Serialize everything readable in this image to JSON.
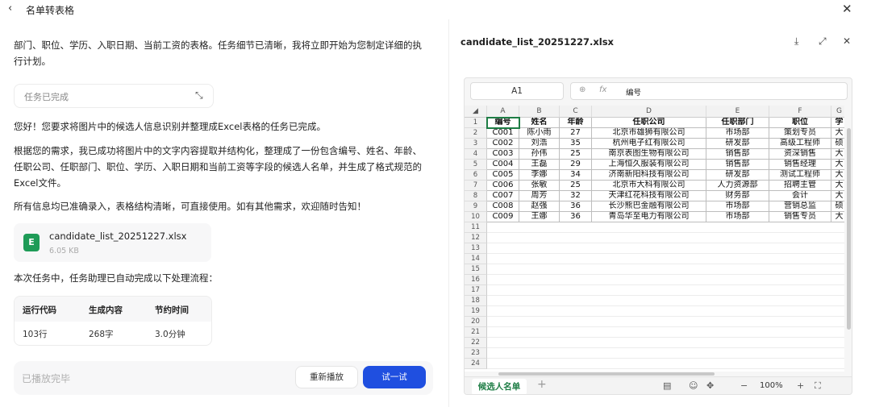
{
  "header": {
    "title": "名单转表格",
    "back": "‹",
    "close": "✕"
  },
  "chat": {
    "line1": "部门、职位、学历、入职日期、当前工资的表格。任务细节已清晰，我将立即开始为您制定详细的执",
    "line2": "行计划。",
    "status_label": "任务已完成",
    "msg1": "您好！您要求将图片中的候选人信息识别并整理成Excel表格的任务已完成。",
    "msg2a": "根据您的需求，我已成功将图片中的文字内容提取并结构化，整理成了一份包含编号、姓名、年龄、",
    "msg2b": "任职公司、任职部门、职位、学历、入职日期和当前工资等字段的候选人名单，并生成了格式规范的",
    "msg2c": "Excel文件。",
    "msg3": "所有信息均已准确录入，表格结构清晰，可直接使用。如有其他需求，欢迎随时告知！",
    "file": {
      "name": "candidate_list_20251227.xlsx",
      "size": "6.05 KB",
      "icon": "E"
    },
    "process_intro": "本次任务中，任务助理已自动完成以下处理流程：",
    "stats": {
      "headers": [
        "运行代码",
        "生成内容",
        "节约时间"
      ],
      "values": [
        "103行",
        "268字",
        "3.0分钟"
      ]
    },
    "composer": {
      "placeholder": "已播放完毕",
      "replay": "重新播放",
      "try": "试一试"
    }
  },
  "viewer": {
    "title": "candidate_list_20251227.xlsx",
    "icons": [
      "download-icon",
      "expand-icon",
      "close-icon"
    ],
    "namebox": "A1",
    "formula_value": "编号",
    "columns": [
      "A",
      "B",
      "C",
      "D",
      "E",
      "F",
      "G"
    ],
    "rows": [
      [
        "编号",
        "姓名",
        "年龄",
        "任职公司",
        "任职部门",
        "职位",
        "学"
      ],
      [
        "C001",
        "陈小雨",
        "27",
        "北京市雄狮有限公司",
        "市场部",
        "策划专员",
        "大"
      ],
      [
        "C002",
        "刘浩",
        "35",
        "杭州电子红有限公司",
        "研发部",
        "高级工程师",
        "硕"
      ],
      [
        "C003",
        "孙伟",
        "25",
        "南京表图生物有限公司",
        "销售部",
        "资深销售",
        "大"
      ],
      [
        "C004",
        "王磊",
        "29",
        "上海恒久服装有限公司",
        "销售部",
        "销售经理",
        "大"
      ],
      [
        "C005",
        "李娜",
        "34",
        "济南新阳科技有限公司",
        "研发部",
        "测试工程师",
        "大"
      ],
      [
        "C006",
        "张敏",
        "25",
        "北京市大科有限公司",
        "人力资源部",
        "招聘主管",
        "大"
      ],
      [
        "C007",
        "周芳",
        "32",
        "天津红花科技有限公司",
        "财务部",
        "会计",
        "大"
      ],
      [
        "C008",
        "赵强",
        "36",
        "长沙熊巴金融有限公司",
        "市场部",
        "营销总监",
        "硕"
      ],
      [
        "C009",
        "王娜",
        "36",
        "青岛华至电力有限公司",
        "市场部",
        "销售专员",
        "大"
      ]
    ],
    "row_numbers": [
      "1",
      "2",
      "3",
      "4",
      "5",
      "6",
      "7",
      "8",
      "9",
      "10",
      "11",
      "12",
      "13",
      "14",
      "15",
      "16",
      "17",
      "18",
      "19",
      "20",
      "21",
      "22",
      "23",
      "24"
    ],
    "sheet_tab": "候选人名单",
    "zoom": "100%"
  }
}
